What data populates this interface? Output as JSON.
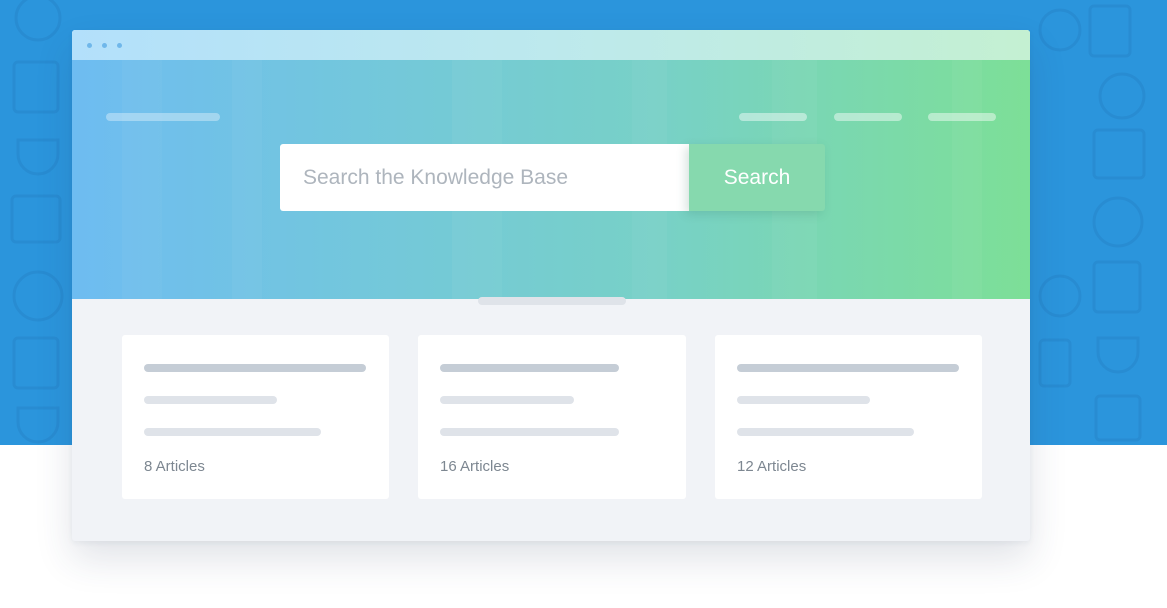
{
  "search": {
    "placeholder": "Search the Knowledge Base",
    "button_label": "Search"
  },
  "categories": [
    {
      "count_label": "8 Articles"
    },
    {
      "count_label": "16 Articles"
    },
    {
      "count_label": "12 Articles"
    }
  ],
  "colors": {
    "page_background": "#2b95dc",
    "hero_gradient_start": "#6ebcf1",
    "hero_gradient_end": "#7ddf97",
    "search_button": "#86d9ae",
    "content_background": "#f1f3f7"
  }
}
